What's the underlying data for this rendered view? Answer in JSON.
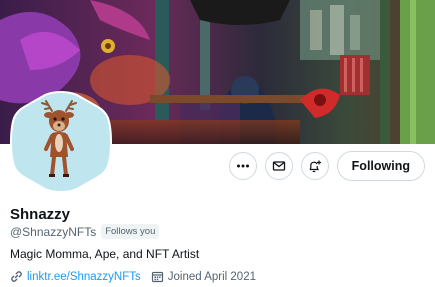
{
  "profile": {
    "display_name": "Shnazzy",
    "handle": "@ShnazzyNFTs",
    "follows_you_badge": "Follows you",
    "bio": "Magic Momma, Ape, and NFT Artist",
    "link_text": "linktr.ee/ShnazzyNFTs",
    "joined": "Joined April 2021"
  },
  "actions": {
    "following_label": "Following",
    "more_icon": "more-horizontal-icon",
    "message_icon": "envelope-icon",
    "notify_icon": "bell-plus-icon"
  },
  "colors": {
    "link": "#1d9bf0",
    "secondary_text": "#536471",
    "avatar_background": "#bfe5ee",
    "button_border": "#cfd9de"
  }
}
